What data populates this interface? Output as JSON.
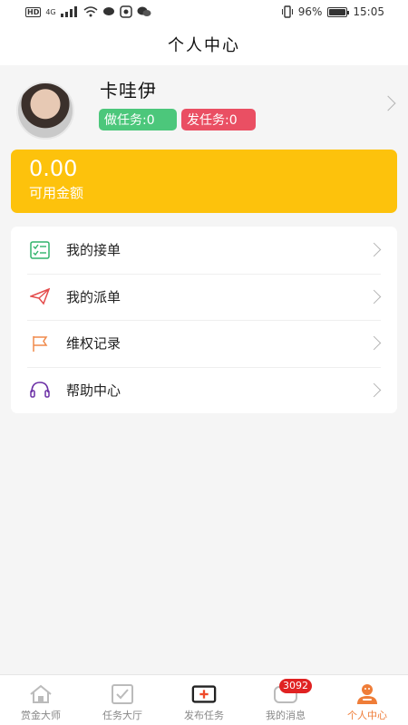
{
  "status_bar": {
    "network": "HD",
    "signal_tag": "4G",
    "battery_percent": "96%",
    "time": "15:05"
  },
  "nav": {
    "title": "个人中心"
  },
  "profile": {
    "username": "卡哇伊",
    "do_tasks": "做任务:0",
    "post_tasks": "发任务:0"
  },
  "balance": {
    "amount": "0.00",
    "label": "可用金额"
  },
  "menu": {
    "items": [
      {
        "label": "我的接单",
        "icon": "checklist-icon"
      },
      {
        "label": "我的派单",
        "icon": "paper-plane-icon"
      },
      {
        "label": "维权记录",
        "icon": "flag-icon"
      },
      {
        "label": "帮助中心",
        "icon": "headset-icon"
      }
    ]
  },
  "tabbar": {
    "items": [
      {
        "label": "赏金大师",
        "icon": "home-icon"
      },
      {
        "label": "任务大厅",
        "icon": "checkbox-icon"
      },
      {
        "label": "发布任务",
        "icon": "add-icon"
      },
      {
        "label": "我的消息",
        "icon": "message-icon",
        "badge": "3092"
      },
      {
        "label": "个人中心",
        "icon": "user-icon",
        "active": true
      }
    ]
  },
  "colors": {
    "accent": "#ef7d38",
    "balance": "#fdc20c",
    "green": "#4cc77b",
    "red": "#ea4f63"
  }
}
